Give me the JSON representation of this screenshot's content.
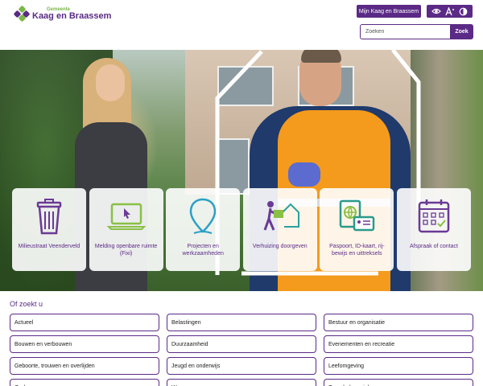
{
  "header": {
    "logo_small": "Gemeente",
    "logo_name": "Kaag en Braassem",
    "mijn_button": "Mijn Kaag en Braassem",
    "search_placeholder": "Zoeken",
    "search_button": "Zoek",
    "a11y_icons": [
      "eye-icon",
      "text-size-icon",
      "contrast-icon"
    ]
  },
  "tiles": [
    {
      "label": "Milieustraat Veenderveld",
      "icon": "trash-bin-icon"
    },
    {
      "label": "Melding openbare ruimte (Fixi)",
      "icon": "laptop-icon"
    },
    {
      "label": "Projecten en werkzaamheden",
      "icon": "map-pin-icon"
    },
    {
      "label": "Verhuizing doorgeven",
      "icon": "moving-house-icon"
    },
    {
      "label": "Paspoort, ID-kaart, rij-bewijs en uittreksels",
      "icon": "passport-icon"
    },
    {
      "label": "Afspraak of contact",
      "icon": "calendar-icon"
    }
  ],
  "links_section": {
    "title": "Of zoekt u",
    "items": [
      "Actueel",
      "Belastingen",
      "Bestuur en organisatie",
      "Bouwen en verbouwen",
      "Duurzaamheid",
      "Evenementen en recreatie",
      "Geboorte, trouwen en overlijden",
      "Jeugd en onderwijs",
      "Leefomgeving",
      "Ondernemen",
      "Wonen",
      "Zorg, hulp en inkomen"
    ]
  },
  "colors": {
    "brand_purple": "#5b2a86",
    "brand_green": "#7ab648"
  }
}
